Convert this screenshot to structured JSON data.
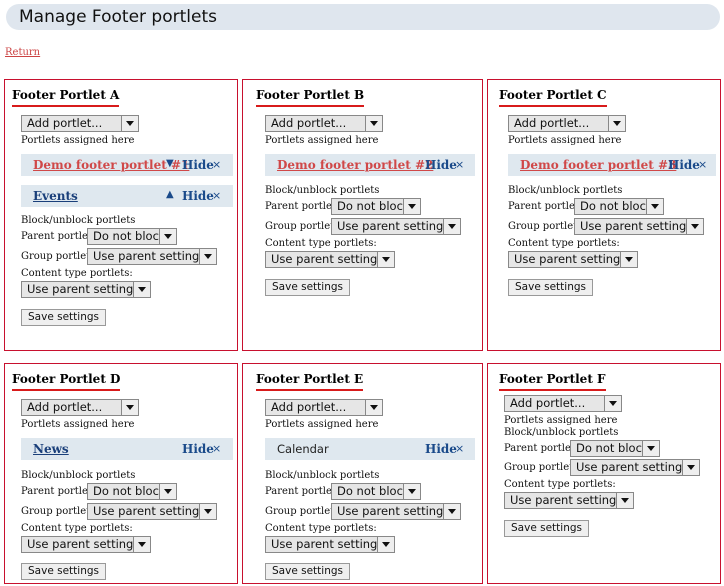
{
  "page": {
    "title": "Manage Footer portlets",
    "return_label": "Return"
  },
  "labels": {
    "add_portlet": "Add portlet...",
    "assigned": "Portlets assigned here",
    "block_unblock": "Block/unblock portlets",
    "parent_portlets": "Parent portlets:",
    "group_portlets": "Group portlets:",
    "content_type_portlets": "Content type portlets:",
    "do_not_block": "Do not block",
    "use_parent": "Use parent settings",
    "save": "Save settings",
    "hide": "Hide",
    "close_glyph": "×",
    "down_glyph": "▼",
    "up_glyph": "▲"
  },
  "columns": [
    {
      "title": "Footer Portlet A",
      "portlets": [
        {
          "name": "Demo footer portlet #1"
        },
        {
          "name": "Events"
        }
      ]
    },
    {
      "title": "Footer Portlet B",
      "portlets": [
        {
          "name": "Demo footer portlet #2"
        }
      ]
    },
    {
      "title": "Footer Portlet C",
      "portlets": [
        {
          "name": "Demo footer portlet #3"
        }
      ]
    },
    {
      "title": "Footer Portlet D",
      "portlets": [
        {
          "name": "News"
        }
      ]
    },
    {
      "title": "Footer Portlet E",
      "portlets": [
        {
          "name": "Calendar"
        }
      ]
    },
    {
      "title": "Footer Portlet F",
      "portlets": []
    }
  ]
}
